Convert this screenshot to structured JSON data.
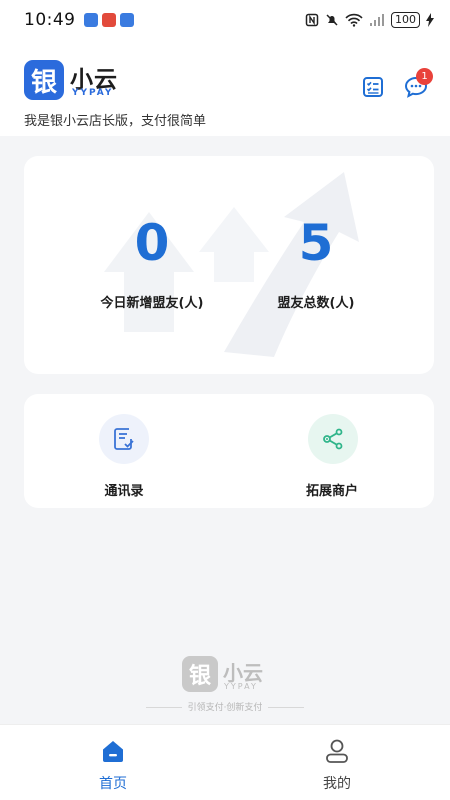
{
  "status_bar": {
    "time": "10:49",
    "battery": "100"
  },
  "header": {
    "logo_char": "银",
    "app_name": "小云",
    "app_name_en": "YYPAY",
    "slogan": "我是银小云店长版，支付很简单",
    "message_badge": "1"
  },
  "stats": [
    {
      "value": "0",
      "label": "今日新增盟友(人)"
    },
    {
      "value": "5",
      "label": "盟友总数(人)"
    }
  ],
  "actions": [
    {
      "label": "通讯录",
      "icon": "contacts-note-icon"
    },
    {
      "label": "拓展商户",
      "icon": "share-icon"
    }
  ],
  "footer_brand": {
    "logo_char": "银",
    "name": "小云",
    "name_en": "YYPAY",
    "slogan": "引领支付·创新支付"
  },
  "tabs": [
    {
      "label": "首页",
      "active": true,
      "icon": "home-icon"
    },
    {
      "label": "我的",
      "active": false,
      "icon": "person-icon"
    }
  ],
  "colors": {
    "primary": "#1f6ed4",
    "badge": "#e9423b",
    "background": "#f4f5f7",
    "action_green": "#2fb58a",
    "action_blue": "#3b74d6"
  }
}
